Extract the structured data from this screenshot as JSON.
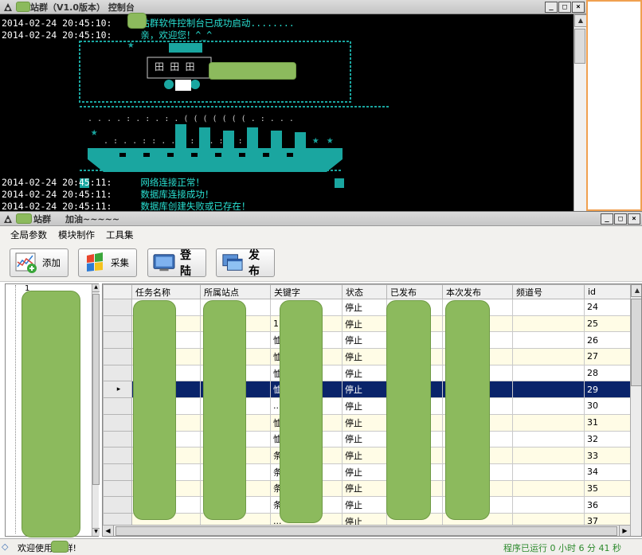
{
  "console": {
    "title_suffix": "站群（V1.0版本）  控制台",
    "lines": [
      {
        "time": "2014-02-24 20:45:10:",
        "msg": "站群软件控制台已成功启动........"
      },
      {
        "time": "2014-02-24 20:45:10:",
        "msg": "亲，欢迎您！^_^"
      },
      {
        "time": "2014-02-24 20:45:11:",
        "msg": "网络连接正常！"
      },
      {
        "time": "2014-02-24 20:45:11:",
        "msg": "数据库连接成功！"
      },
      {
        "time": "2014-02-24 20:45:11:",
        "msg": "数据库创建失败或已存在！"
      }
    ]
  },
  "main": {
    "title_suffix": "站群",
    "title_extra": "加油~~~~~"
  },
  "menu": [
    "全局参数",
    "模块制作",
    "工具集"
  ],
  "toolbar": [
    {
      "label": "添加",
      "icon": "chart-add-icon"
    },
    {
      "label": "采集",
      "icon": "colorful-grid-icon"
    },
    {
      "label": "登陆",
      "icon": "monitor-icon"
    },
    {
      "label": "发布",
      "icon": "windows-icon"
    }
  ],
  "tree": {
    "first_item": "1"
  },
  "grid": {
    "columns": [
      "任务名称",
      "所属站点",
      "关键字",
      "状态",
      "已发布",
      "本次发布",
      "频道号",
      "id"
    ],
    "rows": [
      {
        "keyword": "",
        "status": "停止",
        "id": "24"
      },
      {
        "keyword": "1 4...",
        "status": "停止",
        "id": "25"
      },
      {
        "keyword": "恤...",
        "status": "停止",
        "id": "26"
      },
      {
        "keyword": "恤...",
        "status": "停止",
        "id": "27"
      },
      {
        "keyword": "恤...",
        "status": "停止",
        "id": "28"
      },
      {
        "keyword": "恤...",
        "status": "停止",
        "id": "29"
      },
      {
        "keyword": "...",
        "status": "停止",
        "id": "30"
      },
      {
        "keyword": "恤...",
        "status": "停止",
        "id": "31"
      },
      {
        "keyword": "恤...",
        "status": "停止",
        "id": "32"
      },
      {
        "keyword": "条...",
        "status": "停止",
        "id": "33"
      },
      {
        "keyword": "条...",
        "status": "停止",
        "id": "34"
      },
      {
        "keyword": "条...",
        "status": "停止",
        "id": "35"
      },
      {
        "keyword": "条...",
        "status": "停止",
        "id": "36"
      },
      {
        "keyword": "...",
        "status": "停止",
        "id": "37"
      }
    ],
    "selected_id": "29"
  },
  "status": {
    "left": "欢迎使用   站群!",
    "right": "程序已运行 0 小时 6 分 41 秒"
  }
}
